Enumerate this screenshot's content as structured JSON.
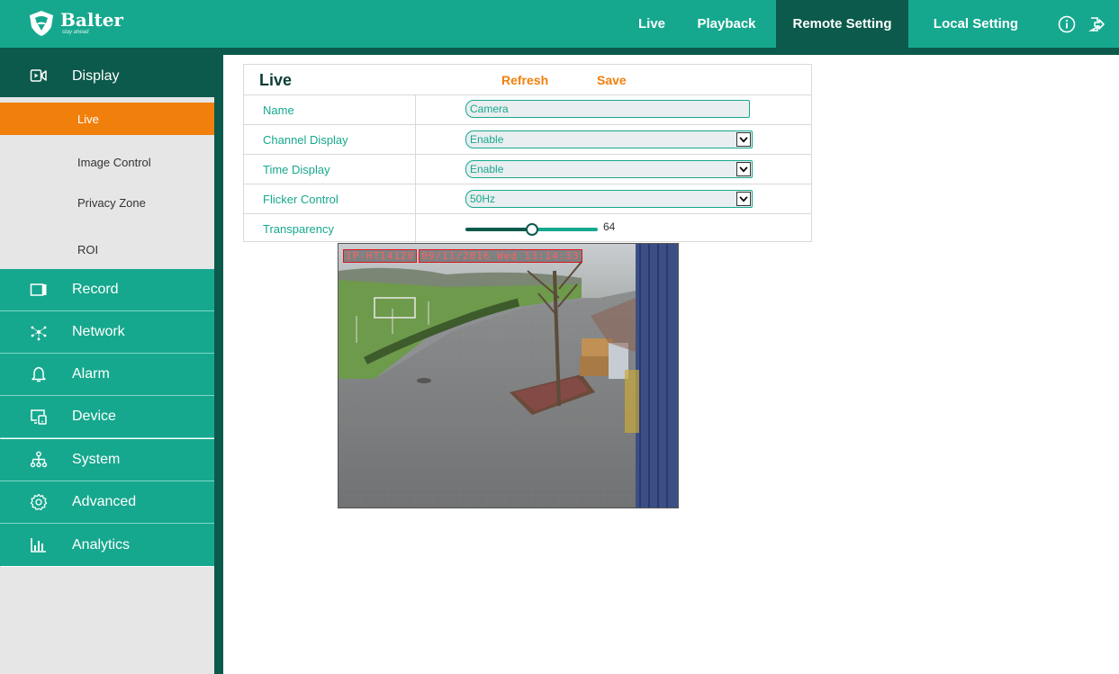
{
  "brand": {
    "name": "Balter",
    "tagline": "stay ahead"
  },
  "topnav": {
    "live": "Live",
    "playback": "Playback",
    "remote_setting": "Remote Setting",
    "local_setting": "Local Setting",
    "active": "Remote Setting"
  },
  "sidebar": {
    "display": {
      "label": "Display",
      "icon": "display-icon"
    },
    "sub_items": [
      {
        "label": "Live",
        "active": true
      },
      {
        "label": "Image Control"
      },
      {
        "label": "Privacy Zone"
      },
      {
        "label": "ROI"
      }
    ],
    "menus": [
      {
        "label": "Record",
        "icon": "record-icon"
      },
      {
        "label": "Network",
        "icon": "network-icon"
      },
      {
        "label": "Alarm",
        "icon": "bell-icon"
      },
      {
        "label": "Device",
        "icon": "device-icon"
      },
      {
        "label": "System",
        "icon": "system-icon"
      },
      {
        "label": "Advanced",
        "icon": "gear-icon"
      },
      {
        "label": "Analytics",
        "icon": "analytics-icon"
      }
    ]
  },
  "panel": {
    "title": "Live",
    "refresh": "Refresh",
    "save": "Save",
    "rows": {
      "name": {
        "label": "Name",
        "value": "Camera"
      },
      "channel_display": {
        "label": "Channel Display",
        "value": "Enable"
      },
      "time_display": {
        "label": "Time Display",
        "value": "Enable"
      },
      "flicker_control": {
        "label": "Flicker Control",
        "value": "50Hz"
      },
      "transparency": {
        "label": "Transparency",
        "value": "64"
      }
    }
  },
  "preview": {
    "osd_name": "IP-HT14120",
    "osd_datetime": "09/11/2016 Wed 13:14:33"
  },
  "colors": {
    "primary": "#16a88e",
    "dark": "#0c5a4c",
    "accent": "#f17f0c"
  }
}
